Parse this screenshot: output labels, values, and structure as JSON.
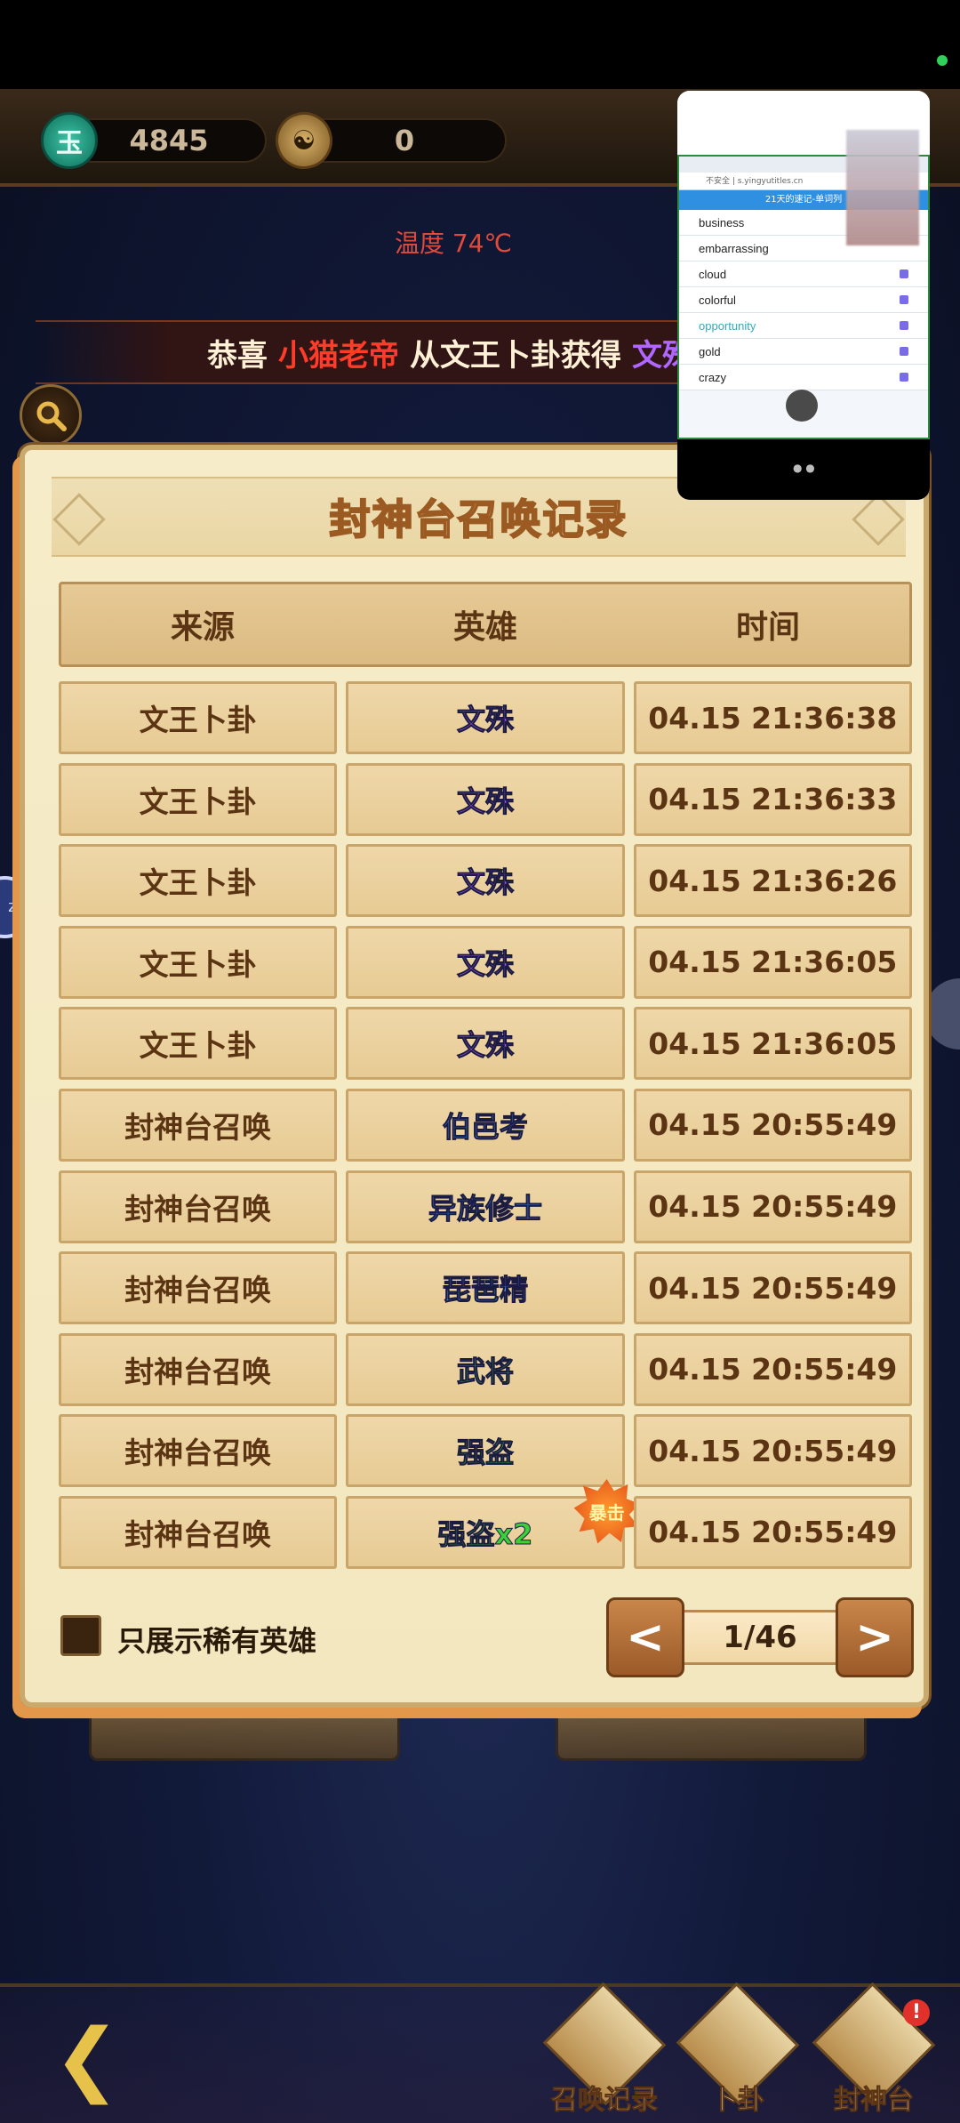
{
  "status": {
    "dot_color": "#2fd15a"
  },
  "resources": {
    "coin_value": "4845",
    "taiji_value": "0",
    "coin_icon": "jade-coin-icon",
    "taiji_icon": "taiji-coin-icon"
  },
  "temperature": "温度 74℃",
  "marquee": {
    "p1": "恭喜",
    "p2": "小猫老帝",
    "p3": "从文王卜卦获得",
    "p4": "文殊广法"
  },
  "panel": {
    "title": "封神台召唤记录",
    "columns": [
      "来源",
      "英雄",
      "时间"
    ],
    "rows": [
      {
        "source": "文王卜卦",
        "hero": "文殊",
        "color": "#b052ff",
        "time": "04.15 21:36:38"
      },
      {
        "source": "文王卜卦",
        "hero": "文殊",
        "color": "#b052ff",
        "time": "04.15 21:36:33"
      },
      {
        "source": "文王卜卦",
        "hero": "文殊",
        "color": "#b052ff",
        "time": "04.15 21:36:26"
      },
      {
        "source": "文王卜卦",
        "hero": "文殊",
        "color": "#b052ff",
        "time": "04.15 21:36:05"
      },
      {
        "source": "文王卜卦",
        "hero": "文殊",
        "color": "#b052ff",
        "time": "04.15 21:36:05"
      },
      {
        "source": "封神台召唤",
        "hero": "伯邑考",
        "color": "#3f8cff",
        "time": "04.15 20:55:49"
      },
      {
        "source": "封神台召唤",
        "hero": "异族修士",
        "color": "#3f8cff",
        "time": "04.15 20:55:49"
      },
      {
        "source": "封神台召唤",
        "hero": "琵琶精",
        "color": "#3f8cff",
        "time": "04.15 20:55:49"
      },
      {
        "source": "封神台召唤",
        "hero": "武将",
        "color": "#3ccf3a",
        "time": "04.15 20:55:49"
      },
      {
        "source": "封神台召唤",
        "hero": "强盗",
        "color": "#3ccf3a",
        "time": "04.15 20:55:49"
      },
      {
        "source": "封神台召唤",
        "hero": "强盗x2",
        "color": "#3ccf3a",
        "time": "04.15 20:55:49",
        "badge": "暴击"
      }
    ],
    "filter_label": "只展示稀有英雄",
    "pager": {
      "prev": "<",
      "next": ">",
      "page": "1/46"
    }
  },
  "overlay": {
    "tab_title": "21天的速记-单词列",
    "url": "不安全 | s.yingyutitles.cn",
    "app_header": "21天的速记-单词列",
    "words": [
      "business",
      "embarrassing",
      "cloud",
      "colorful",
      "opportunity",
      "gold",
      "crazy"
    ],
    "highlight_index": 4
  },
  "bottom_nav": {
    "items": [
      "召唤记录",
      "卜卦",
      "封神台"
    ]
  },
  "colors": {
    "panel_bg": "#f6ecc9",
    "accent": "#c9864a"
  }
}
